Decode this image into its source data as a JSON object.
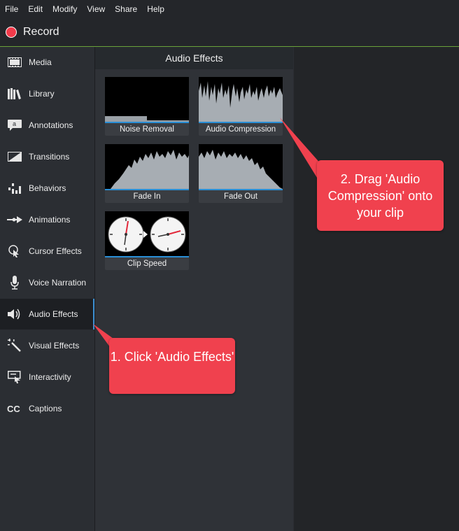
{
  "menu": [
    "File",
    "Edit",
    "Modify",
    "View",
    "Share",
    "Help"
  ],
  "record": {
    "label": "Record"
  },
  "sidebar": {
    "items": [
      {
        "label": "Media",
        "icon": "film-strip-icon"
      },
      {
        "label": "Library",
        "icon": "books-icon"
      },
      {
        "label": "Annotations",
        "icon": "annotation-icon"
      },
      {
        "label": "Transitions",
        "icon": "transition-icon"
      },
      {
        "label": "Behaviors",
        "icon": "behaviors-icon"
      },
      {
        "label": "Animations",
        "icon": "animation-arrow-icon"
      },
      {
        "label": "Cursor Effects",
        "icon": "cursor-icon"
      },
      {
        "label": "Voice Narration",
        "icon": "microphone-icon"
      },
      {
        "label": "Audio Effects",
        "icon": "speaker-icon"
      },
      {
        "label": "Visual Effects",
        "icon": "magic-wand-icon"
      },
      {
        "label": "Interactivity",
        "icon": "interactivity-icon"
      },
      {
        "label": "Captions",
        "icon": "cc-icon"
      }
    ],
    "active_index": 8
  },
  "panel": {
    "title": "Audio Effects",
    "effects": [
      {
        "label": "Noise Removal"
      },
      {
        "label": "Audio Compression"
      },
      {
        "label": "Fade In"
      },
      {
        "label": "Fade Out"
      },
      {
        "label": "Clip Speed"
      }
    ]
  },
  "callouts": {
    "step1": "1. Click 'Audio Effects'",
    "step2": "2. Drag 'Audio Compression' onto your clip"
  },
  "colors": {
    "accent": "#3c8fd1",
    "record": "#f23a4a",
    "callout": "#f0414e",
    "record_bar_line": "#6aa23a"
  }
}
